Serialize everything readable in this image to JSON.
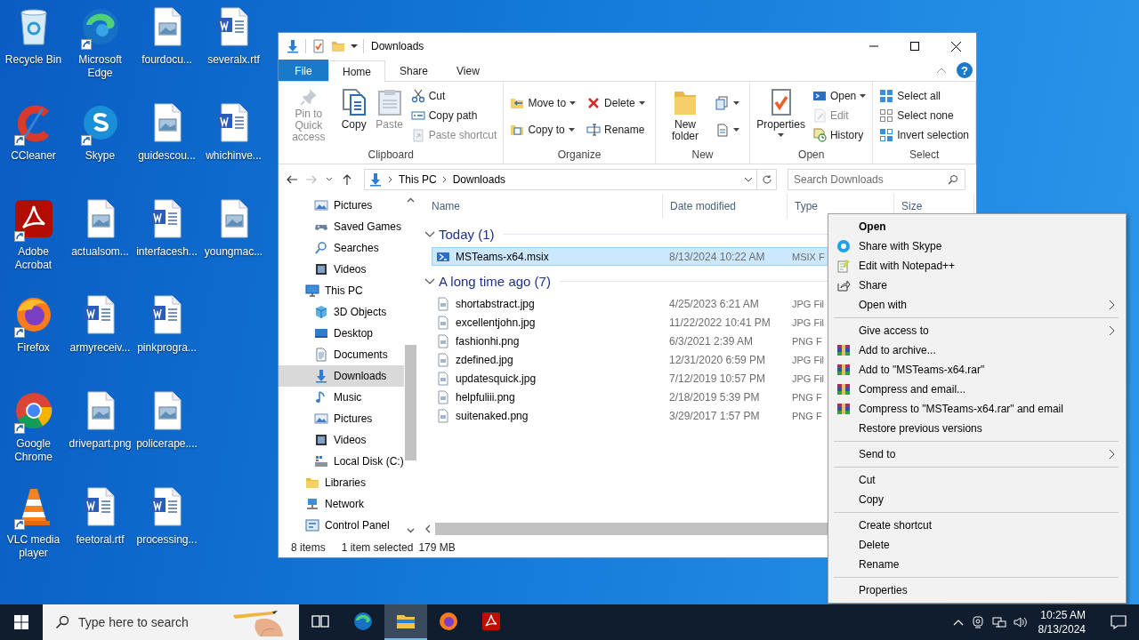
{
  "desktop": {
    "columns": [
      [
        {
          "kind": "recycle",
          "label": "Recycle Bin",
          "shortcut": false
        },
        {
          "kind": "ccleaner",
          "label": "CCleaner",
          "shortcut": true
        },
        {
          "kind": "acrobat",
          "label": "Adobe Acrobat",
          "shortcut": true
        },
        {
          "kind": "firefox",
          "label": "Firefox",
          "shortcut": true
        },
        {
          "kind": "chrome",
          "label": "Google Chrome",
          "shortcut": true
        },
        {
          "kind": "vlc",
          "label": "VLC media player",
          "shortcut": true
        }
      ],
      [
        {
          "kind": "edge",
          "label": "Microsoft Edge",
          "shortcut": true
        },
        {
          "kind": "skype",
          "label": "Skype",
          "shortcut": true
        },
        {
          "kind": "image",
          "label": "actualsom...",
          "shortcut": false
        },
        {
          "kind": "word",
          "label": "armyreceiv...",
          "shortcut": false
        },
        {
          "kind": "image",
          "label": "drivepart.png",
          "shortcut": false
        },
        {
          "kind": "word",
          "label": "feetoral.rtf",
          "shortcut": false
        }
      ],
      [
        {
          "kind": "image",
          "label": "fourdocu...",
          "shortcut": false
        },
        {
          "kind": "image",
          "label": "guidescou...",
          "shortcut": false
        },
        {
          "kind": "word",
          "label": "interfacesh...",
          "shortcut": false
        },
        {
          "kind": "word",
          "label": "pinkprogra...",
          "shortcut": false
        },
        {
          "kind": "image",
          "label": "policerape....",
          "shortcut": false
        },
        {
          "kind": "word",
          "label": "processing...",
          "shortcut": false
        }
      ],
      [
        {
          "kind": "word",
          "label": "severalx.rtf",
          "shortcut": false
        },
        {
          "kind": "word",
          "label": "whichinve...",
          "shortcut": false
        },
        {
          "kind": "image",
          "label": "youngmac...",
          "shortcut": false
        }
      ]
    ]
  },
  "explorer": {
    "title": "Downloads",
    "tabs": [
      {
        "kind": "file",
        "label": "File",
        "selected": false
      },
      {
        "kind": "tab",
        "label": "Home",
        "selected": true
      },
      {
        "kind": "tab",
        "label": "Share",
        "selected": false
      },
      {
        "kind": "tab",
        "label": "View",
        "selected": false
      }
    ],
    "help": "?",
    "ribbon": [
      {
        "label": "Clipboard",
        "columns": [
          [
            {
              "kind": "pin",
              "large": true,
              "label": "Pin to Quick access",
              "disabled": true,
              "dropdown": false
            }
          ],
          [
            {
              "kind": "copy",
              "large": true,
              "label": "Copy",
              "disabled": false,
              "dropdown": false
            }
          ],
          [
            {
              "kind": "paste",
              "large": true,
              "label": "Paste",
              "disabled": true,
              "dropdown": false
            }
          ],
          [
            {
              "kind": "cut",
              "large": false,
              "label": "Cut",
              "disabled": false,
              "dropdown": false
            },
            {
              "kind": "copypath",
              "large": false,
              "label": "Copy path",
              "disabled": false,
              "dropdown": false
            },
            {
              "kind": "pasteshortcut",
              "large": false,
              "label": "Paste shortcut",
              "disabled": true,
              "dropdown": false
            }
          ]
        ]
      },
      {
        "label": "Organize",
        "columns": [
          [
            {
              "kind": "moveto",
              "large": false,
              "label": "Move to",
              "disabled": false,
              "dropdown": true
            },
            {
              "kind": "copyto",
              "large": false,
              "label": "Copy to",
              "disabled": false,
              "dropdown": true
            }
          ],
          [
            {
              "kind": "delete",
              "large": false,
              "label": "Delete",
              "disabled": false,
              "dropdown": true
            },
            {
              "kind": "rename",
              "large": false,
              "label": "Rename",
              "disabled": false,
              "dropdown": false
            }
          ]
        ]
      },
      {
        "label": "New",
        "columns": [
          [
            {
              "kind": "newfolder",
              "large": true,
              "label": "New folder",
              "disabled": false,
              "dropdown": false
            }
          ],
          [
            {
              "kind": "newitem",
              "large": false,
              "disabled": false,
              "dropdown": true
            },
            {
              "kind": "easyaccess",
              "large": false,
              "disabled": false,
              "dropdown": true
            }
          ]
        ]
      },
      {
        "label": "Open",
        "columns": [
          [
            {
              "kind": "properties",
              "large": true,
              "label": "Properties",
              "disabled": false,
              "dropdown": true
            }
          ],
          [
            {
              "kind": "open",
              "large": false,
              "label": "Open",
              "disabled": false,
              "dropdown": true
            },
            {
              "kind": "edit",
              "large": false,
              "label": "Edit",
              "disabled": true,
              "dropdown": false
            },
            {
              "kind": "history",
              "large": false,
              "label": "History",
              "disabled": false,
              "dropdown": false
            }
          ]
        ]
      },
      {
        "label": "Select",
        "columns": [
          [
            {
              "kind": "selectall",
              "large": false,
              "label": "Select all",
              "disabled": false,
              "dropdown": false
            },
            {
              "kind": "selectnone",
              "large": false,
              "label": "Select none",
              "disabled": false,
              "dropdown": false
            },
            {
              "kind": "invert",
              "large": false,
              "label": "Invert selection",
              "disabled": false,
              "dropdown": false
            }
          ]
        ]
      }
    ],
    "crumbs": [
      "This PC",
      "Downloads"
    ],
    "search_placeholder": "Search Downloads",
    "nav": {
      "partial": [
        {
          "kind": "pictures",
          "label": "Pictures",
          "selected": false
        },
        {
          "kind": "games",
          "label": "Saved Games",
          "selected": false
        },
        {
          "kind": "search",
          "label": "Searches",
          "selected": false
        },
        {
          "kind": "videos",
          "label": "Videos",
          "selected": false
        }
      ],
      "items": [
        {
          "kind": "pc",
          "label": "This PC",
          "selected": false,
          "children": [
            {
              "kind": "cube",
              "label": "3D Objects",
              "selected": false
            },
            {
              "kind": "desktop",
              "label": "Desktop",
              "selected": false
            },
            {
              "kind": "documents",
              "label": "Documents",
              "selected": false
            },
            {
              "kind": "downloads",
              "label": "Downloads",
              "selected": true
            },
            {
              "kind": "music",
              "label": "Music",
              "selected": false
            },
            {
              "kind": "pictures",
              "label": "Pictures",
              "selected": false
            },
            {
              "kind": "videos",
              "label": "Videos",
              "selected": false
            },
            {
              "kind": "disk",
              "label": "Local Disk (C:)",
              "selected": false
            }
          ]
        },
        {
          "kind": "libraries",
          "label": "Libraries",
          "selected": false
        },
        {
          "kind": "network",
          "label": "Network",
          "selected": false
        },
        {
          "kind": "control",
          "label": "Control Panel",
          "selected": false
        }
      ]
    },
    "columns": [
      "Name",
      "Date modified",
      "Type",
      "Size"
    ],
    "groups": [
      {
        "label": "Today (1)",
        "expanded": true,
        "rows": [
          {
            "kind": "msix",
            "name": "MSTeams-x64.msix",
            "date": "8/13/2024 10:22 AM",
            "type": "MSIX F",
            "selected": true
          }
        ]
      },
      {
        "label": "A long time ago (7)",
        "expanded": true,
        "rows": [
          {
            "kind": "imagefile",
            "name": "shortabstract.jpg",
            "date": "4/25/2023 6:21 AM",
            "type": "JPG Fil",
            "selected": false
          },
          {
            "kind": "imagefile",
            "name": "excellentjohn.jpg",
            "date": "11/22/2022 10:41 PM",
            "type": "JPG Fil",
            "selected": false
          },
          {
            "kind": "imagefile",
            "name": "fashionhi.png",
            "date": "6/3/2021 2:39 AM",
            "type": "PNG F",
            "selected": false
          },
          {
            "kind": "imagefile",
            "name": "zdefined.jpg",
            "date": "12/31/2020 6:59 PM",
            "type": "JPG Fil",
            "selected": false
          },
          {
            "kind": "imagefile",
            "name": "updatesquick.jpg",
            "date": "7/12/2019 10:57 PM",
            "type": "JPG Fil",
            "selected": false
          },
          {
            "kind": "imagefile",
            "name": "helpfuliii.png",
            "date": "2/18/2019 5:39 PM",
            "type": "PNG F",
            "selected": false
          },
          {
            "kind": "imagefile",
            "name": "suitenaked.png",
            "date": "3/29/2017 1:57 PM",
            "type": "PNG F",
            "selected": false
          }
        ]
      }
    ],
    "status": {
      "count": "8 items",
      "selection": "1 item selected",
      "size": "179 MB"
    }
  },
  "context_menu": [
    {
      "kind": "plain",
      "label": "Open",
      "default": true,
      "submenu": false
    },
    {
      "kind": "skype",
      "label": "Share with Skype",
      "default": false,
      "submenu": false
    },
    {
      "kind": "notepad",
      "label": "Edit with Notepad++",
      "default": false,
      "submenu": false
    },
    {
      "kind": "share",
      "label": "Share",
      "default": false,
      "submenu": false
    },
    {
      "kind": "plain",
      "label": "Open with",
      "default": false,
      "submenu": true
    },
    {
      "kind": "separator"
    },
    {
      "kind": "plain",
      "label": "Give access to",
      "default": false,
      "submenu": true
    },
    {
      "kind": "archive",
      "label": "Add to archive...",
      "default": false,
      "submenu": false
    },
    {
      "kind": "archive",
      "label": "Add to \"MSTeams-x64.rar\"",
      "default": false,
      "submenu": false
    },
    {
      "kind": "archive",
      "label": "Compress and email...",
      "default": false,
      "submenu": false
    },
    {
      "kind": "archive",
      "label": "Compress to \"MSTeams-x64.rar\" and email",
      "default": false,
      "submenu": false
    },
    {
      "kind": "plain",
      "label": "Restore previous versions",
      "default": false,
      "submenu": false
    },
    {
      "kind": "separator"
    },
    {
      "kind": "plain",
      "label": "Send to",
      "default": false,
      "submenu": true
    },
    {
      "kind": "separator"
    },
    {
      "kind": "plain",
      "label": "Cut",
      "default": false,
      "submenu": false
    },
    {
      "kind": "plain",
      "label": "Copy",
      "default": false,
      "submenu": false
    },
    {
      "kind": "separator"
    },
    {
      "kind": "plain",
      "label": "Create shortcut",
      "default": false,
      "submenu": false
    },
    {
      "kind": "plain",
      "label": "Delete",
      "default": false,
      "submenu": false
    },
    {
      "kind": "plain",
      "label": "Rename",
      "default": false,
      "submenu": false
    },
    {
      "kind": "separator"
    },
    {
      "kind": "plain",
      "label": "Properties",
      "default": false,
      "submenu": false
    }
  ],
  "taskbar": {
    "search_placeholder": "Type here to search",
    "apps": [
      {
        "kind": "taskview",
        "active": false
      },
      {
        "kind": "edge",
        "active": false
      },
      {
        "kind": "explorer",
        "active": true
      },
      {
        "kind": "firefox",
        "active": false
      },
      {
        "kind": "acrobat",
        "active": false
      }
    ],
    "time": "10:25 AM",
    "date": "8/13/2024"
  }
}
